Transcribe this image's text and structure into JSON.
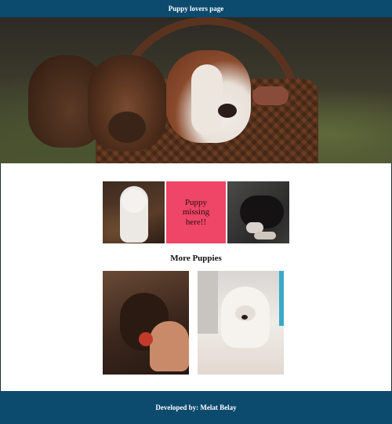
{
  "header": {
    "title": "Puppy lovers page"
  },
  "hero": {
    "image_subject": "three puppies in a wicker basket"
  },
  "gallery": {
    "missing_text": "Puppy missing here!!"
  },
  "more_section": {
    "heading": "More Puppies"
  },
  "footer": {
    "text": "Developed by: Melat Belay"
  },
  "colors": {
    "bar": "#0c4a6e",
    "missing_tile": "#ef4566",
    "background": "#ffffff"
  }
}
